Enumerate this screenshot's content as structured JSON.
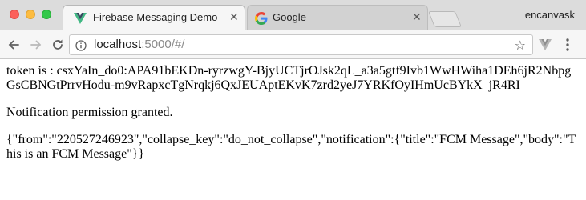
{
  "tabs": [
    {
      "title": "Firebase Messaging Demo",
      "active": true
    },
    {
      "title": "Google",
      "active": false
    }
  ],
  "profile_name": "encanvask",
  "address_bar": {
    "host": "localhost",
    "rest": ":5000/#/"
  },
  "page": {
    "token_label": "token is : ",
    "token_value": "csxYaIn_do0:APA91bEKDn-ryrzwgY-BjyUCTjrOJsk2qL_a3a5gtf9Ivb1WwHWiha1DEh6jR2NbpgGsCBNGtPrrvHodu-m9vRapxcTgNrqkj6QxJEUAptEKvK7zrd2yeJ7YRKfOyIHmUcBYkX_jR4RI",
    "permission_message": "Notification permission granted.",
    "message_json": "{\"from\":\"220527246923\",\"collapse_key\":\"do_not_collapse\",\"notification\":{\"title\":\"FCM Message\",\"body\":\"This is an FCM Message\"}}"
  },
  "icons": {
    "tab1_favicon": "vue-logo-icon",
    "tab2_favicon": "google-g-icon",
    "back": "back-arrow-icon",
    "forward": "forward-arrow-icon",
    "reload": "reload-icon",
    "info": "info-icon",
    "star": "bookmark-star-icon",
    "extension": "vue-devtools-icon",
    "menu": "kebab-menu-icon"
  },
  "colors": {
    "tab_strip": "#dcdcdc",
    "toolbar": "#f6f6f6",
    "url_rest": "#8a8a8a",
    "vue_green": "#41b883",
    "vue_dark": "#35495e"
  }
}
